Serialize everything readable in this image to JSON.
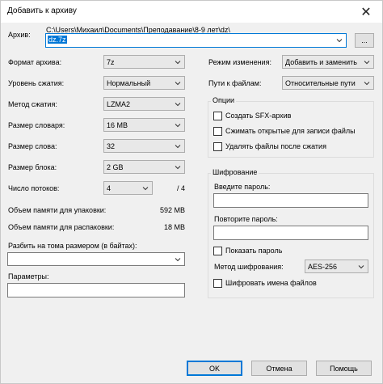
{
  "window": {
    "title": "Добавить к архиву",
    "close_glyph": "✕"
  },
  "archive": {
    "label": "Архив:",
    "path": "C:\\Users\\Михаил\\Documents\\Преподавание\\8-9 лет\\dz\\",
    "filename": "dz.7z",
    "browse_label": "..."
  },
  "left": {
    "format_label": "Формат архива:",
    "format_value": "7z",
    "level_label": "Уровень сжатия:",
    "level_value": "Нормальный",
    "method_label": "Метод сжатия:",
    "method_value": "LZMA2",
    "dict_label": "Размер словаря:",
    "dict_value": "16 MB",
    "word_label": "Размер слова:",
    "word_value": "32",
    "block_label": "Размер блока:",
    "block_value": "2 GB",
    "threads_label": "Число потоков:",
    "threads_value": "4",
    "threads_max": "/ 4",
    "mem_pack_label": "Объем памяти для упаковки:",
    "mem_pack_value": "592 MB",
    "mem_unpack_label": "Объем памяти для распаковки:",
    "mem_unpack_value": "18 MB",
    "split_label": "Разбить на тома размером (в байтах):",
    "split_value": "",
    "params_label": "Параметры:",
    "params_value": ""
  },
  "right": {
    "update_label": "Режим изменения:",
    "update_value": "Добавить и заменить",
    "paths_label": "Пути к файлам:",
    "paths_value": "Относительные пути",
    "options_title": "Опции",
    "opt_sfx": "Создать SFX-архив",
    "opt_shared": "Сжимать открытые для записи файлы",
    "opt_delete": "Удалять файлы после сжатия",
    "enc_title": "Шифрование",
    "pwd_label": "Введите пароль:",
    "pwd2_label": "Повторите пароль:",
    "show_pwd": "Показать пароль",
    "enc_method_label": "Метод шифрования:",
    "enc_method_value": "AES-256",
    "enc_names": "Шифровать имена файлов"
  },
  "buttons": {
    "ok": "OK",
    "cancel": "Отмена",
    "help": "Помощь"
  },
  "icons": {
    "dropdown": "chevron-down-icon",
    "close": "close-icon"
  }
}
